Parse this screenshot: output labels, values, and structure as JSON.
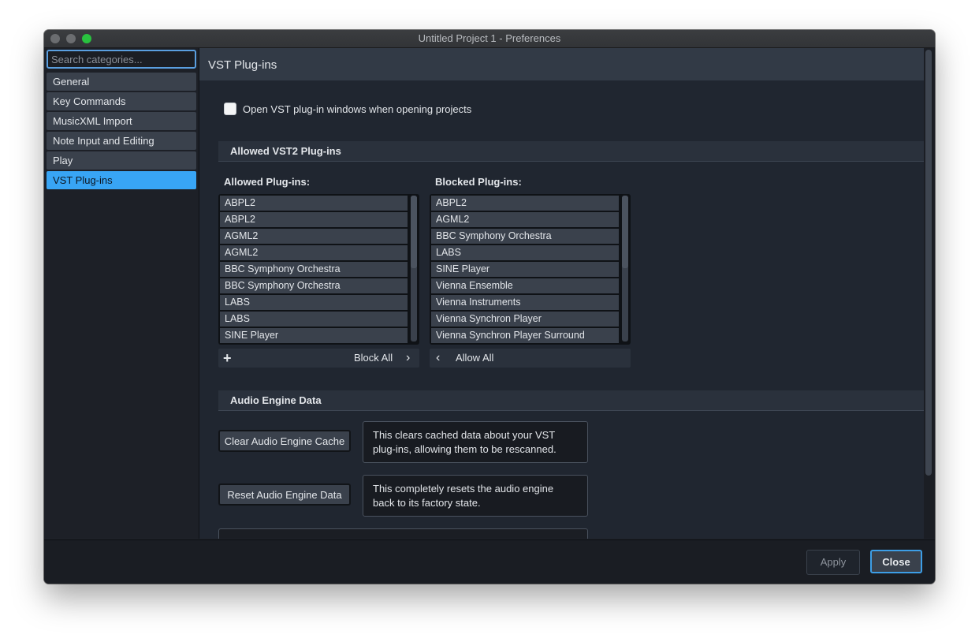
{
  "window": {
    "title": "Untitled Project 1 - Preferences"
  },
  "sidebar": {
    "search_placeholder": "Search categories...",
    "items": [
      {
        "label": "General"
      },
      {
        "label": "Key Commands"
      },
      {
        "label": "MusicXML Import"
      },
      {
        "label": "Note Input and Editing"
      },
      {
        "label": "Play"
      },
      {
        "label": "VST Plug-ins",
        "selected": true
      }
    ]
  },
  "main": {
    "heading": "VST Plug-ins",
    "open_windows_checkbox": {
      "label": "Open VST plug-in windows when opening projects",
      "checked": false
    },
    "allowed_section": {
      "title": "Allowed VST2 Plug-ins",
      "allowed": {
        "label": "Allowed Plug-ins:",
        "items": [
          "ABPL2",
          "ABPL2",
          "AGML2",
          "AGML2",
          "BBC Symphony Orchestra",
          "BBC Symphony Orchestra",
          "LABS",
          "LABS",
          "SINE Player"
        ],
        "footer_action": "Block All",
        "add_icon": "plus-icon",
        "action_icon": "chevron-right-icon"
      },
      "blocked": {
        "label": "Blocked Plug-ins:",
        "items": [
          "ABPL2",
          "AGML2",
          "BBC Symphony Orchestra",
          "LABS",
          "SINE Player",
          "Vienna Ensemble",
          "Vienna Instruments",
          "Vienna Synchron Player",
          "Vienna Synchron Player Surround"
        ],
        "footer_action": "Allow All",
        "action_icon": "chevron-left-icon"
      }
    },
    "audio_engine_section": {
      "title": "Audio Engine Data",
      "clear_button": "Clear Audio Engine Cache",
      "clear_desc": "This clears cached data about your VST plug-ins, allowing them to be rescanned.",
      "reset_button": "Reset Audio Engine Data",
      "reset_desc": "This completely resets the audio engine back to its factory state."
    }
  },
  "footer": {
    "apply_label": "Apply",
    "close_label": "Close"
  },
  "colors": {
    "accent": "#38a5f5",
    "close_border": "#3d9ee6",
    "traffic_green": "#29c23f"
  }
}
